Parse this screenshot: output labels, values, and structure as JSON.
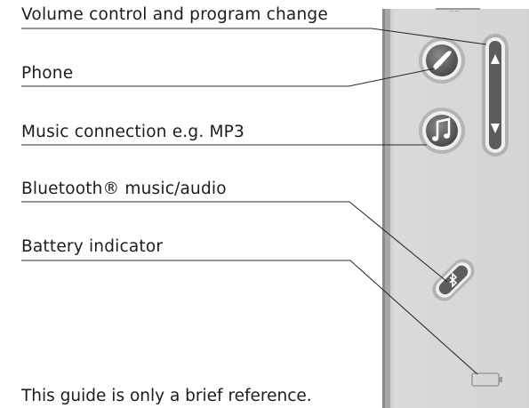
{
  "labels": {
    "volume": "Volume control and program change",
    "phone": "Phone",
    "music": "Music connection e.g. MP3",
    "bluetooth": "Bluetooth® music/audio",
    "battery": "Battery indicator"
  },
  "footer_text": "This guide is only a brief reference.",
  "icons": {
    "phone": "phone-icon",
    "music": "music-note-icon",
    "bluetooth": "bluetooth-icon",
    "volume_up": "triangle-up-icon",
    "volume_down": "triangle-down-icon",
    "battery": "battery-icon"
  },
  "colors": {
    "device_body": "#d6d6d6",
    "button_dark": "#6a6a6a",
    "leader_line": "#2a2a2a"
  }
}
